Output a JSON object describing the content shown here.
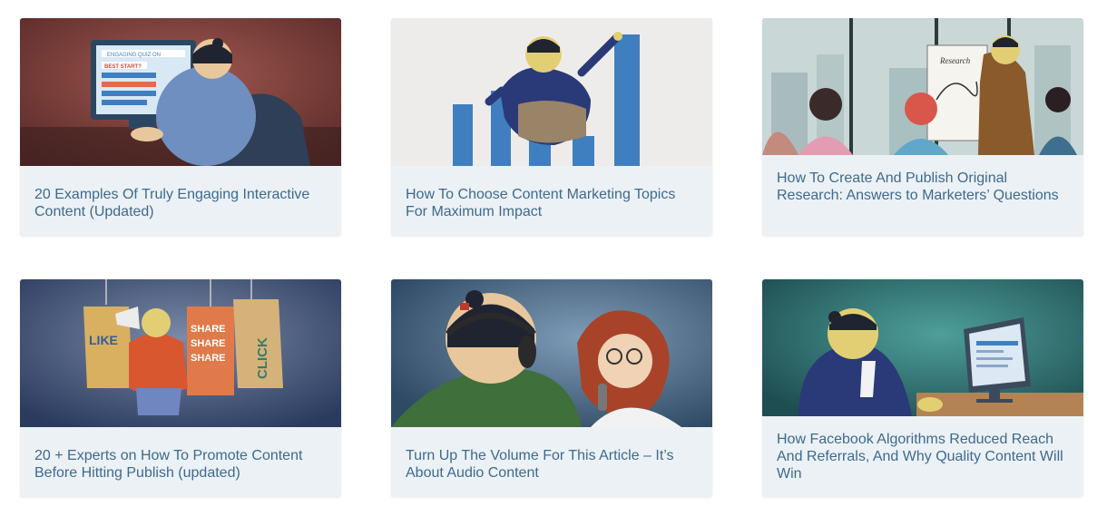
{
  "articles": [
    {
      "title": "20 Examples Of Truly Engaging Interactive Content (Updated)",
      "image": "person-at-computer-illustration",
      "screen_text": [
        "ENGAGING QUIZ ON",
        "BEST START?"
      ]
    },
    {
      "title": "How To Choose Content Marketing Topics For Maximum Impact",
      "image": "person-climbing-bar-chart-illustration"
    },
    {
      "title": "How To Create And Publish Original Research: Answers to Marketers’ Questions",
      "image": "presentation-to-audience-illustration",
      "board_text": "Research"
    },
    {
      "title": "20 + Experts on How To Promote Content Before Hitting Publish (updated)",
      "image": "megaphone-share-tags-illustration",
      "tags": [
        "LIKE",
        "SHARE",
        "SHARE",
        "SHARE",
        "CLICK"
      ]
    },
    {
      "title": "Turn Up The Volume For This Article – It’s About Audio Content",
      "image": "podcast-interview-illustration"
    },
    {
      "title": "How Facebook Algorithms Reduced Reach And Referrals, And Why Quality Content Will Win",
      "image": "person-viewing-monitor-illustration"
    }
  ],
  "colors": {
    "card_background": "#ecf1f5",
    "title_text": "#3d6a8f",
    "accent_blue": "#3f7fbf"
  }
}
